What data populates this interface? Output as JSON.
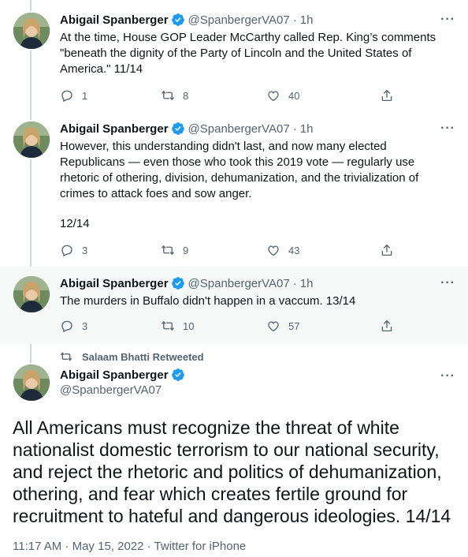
{
  "colors": {
    "verified": "#1d9bf0",
    "muted": "#536471",
    "text": "#0f1419"
  },
  "tweets": [
    {
      "name": "Abigail Spanberger",
      "handle": "@SpanbergerVA07",
      "dot": "·",
      "time": "1h",
      "more": "···",
      "text": "At the time, House GOP Leader McCarthy called Rep. King’s comments \"beneath the dignity of the Party of Lincoln and the United States of America.\" 11/14",
      "replies": "1",
      "retweets": "8",
      "likes": "40"
    },
    {
      "name": "Abigail Spanberger",
      "handle": "@SpanbergerVA07",
      "dot": "·",
      "time": "1h",
      "more": "···",
      "text": "However, this understanding didn't last, and now many elected Republicans — even those who took this 2019 vote — regularly use rhetoric of othering, division, dehumanization, and the trivialization of crimes to attack foes and sow anger.",
      "text2": "12/14",
      "replies": "3",
      "retweets": "9",
      "likes": "43"
    },
    {
      "name": "Abigail Spanberger",
      "handle": "@SpanbergerVA07",
      "dot": "·",
      "time": "1h",
      "more": "···",
      "text": "The murders in Buffalo didn't happen in a vaccum. 13/14",
      "replies": "3",
      "retweets": "10",
      "likes": "57"
    }
  ],
  "main": {
    "retweeted_by": "Salaam Bhatti Retweeted",
    "name": "Abigail Spanberger",
    "handle": "@SpanbergerVA07",
    "more": "···",
    "text": "All Americans must recognize the threat of white nationalist domestic terrorism to our national security, and reject the rhetoric and politics of dehumanization, othering, and fear which creates fertile ground for recruitment to hateful and dangerous ideologies. 14/14",
    "meta": "11:17 AM · May 15, 2022 · Twitter for iPhone"
  },
  "icons": [
    "verified-icon",
    "reply-icon",
    "retweet-icon",
    "like-icon",
    "share-icon",
    "more-icon",
    "retweeted-icon"
  ]
}
